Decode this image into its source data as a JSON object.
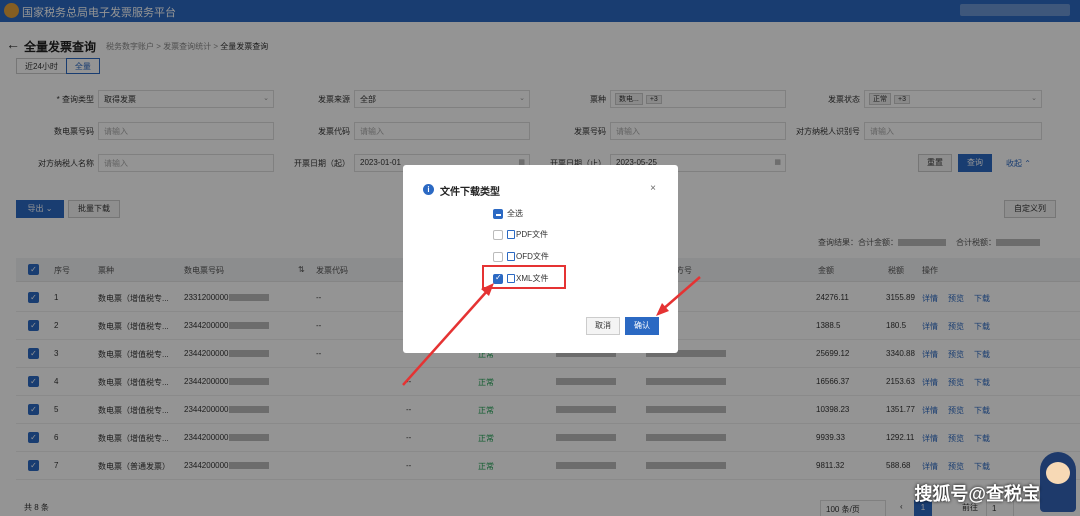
{
  "app": {
    "title": "国家税务总局电子发票服务平台"
  },
  "page": {
    "title": "全量发票查询",
    "breadcrumb": [
      "税务数字账户",
      "发票查询统计",
      "全量发票查询"
    ],
    "back_icon": "arrow-left-icon"
  },
  "time_tabs": [
    "近24小时",
    "全量"
  ],
  "filters": {
    "query_type": {
      "label": "* 查询类型",
      "value": "取得发票"
    },
    "invoice_source": {
      "label": "发票来源",
      "value": "全部"
    },
    "invoice_kind": {
      "label": "票种",
      "tag": "数电...",
      "more": "+3"
    },
    "invoice_status": {
      "label": "发票状态",
      "tag": "正常",
      "more": "+3"
    },
    "digital_no": {
      "label": "数电票号码",
      "placeholder": "请输入"
    },
    "invoice_code": {
      "label": "发票代码",
      "placeholder": "请输入"
    },
    "invoice_no": {
      "label": "发票号码",
      "placeholder": "请输入"
    },
    "counterparty_id": {
      "label": "对方纳税人识别号",
      "placeholder": "请输入"
    },
    "counterparty_name": {
      "label": "对方纳税人名称",
      "placeholder": "请输入"
    },
    "date_start": {
      "label": "开票日期（起）",
      "value": "2023-01-01"
    },
    "date_end": {
      "label": "开票日期（止）",
      "value": "2023-05-25"
    }
  },
  "buttons": {
    "reset": "重置",
    "search": "查询",
    "collapse": "收起",
    "export": "导出",
    "batch_download": "批量下载",
    "custom_columns": "自定义列"
  },
  "summary": {
    "result": "查询结果：",
    "total_amount": "合计金额：",
    "total_tax": "合计税额："
  },
  "table": {
    "headers": [
      "序号",
      "票种",
      "数电票号码",
      "发票代码",
      "",
      "",
      "对方号",
      "金额",
      "税额",
      "操作"
    ],
    "rows": [
      {
        "no": "1",
        "kind": "数电票（增值税专...",
        "number": "2331200000",
        "code": "--",
        "status": "",
        "amount": "24276.11",
        "tax": "3155.89"
      },
      {
        "no": "2",
        "kind": "数电票（增值税专...",
        "number": "2344200000",
        "code": "--",
        "status": "",
        "amount": "1388.5",
        "tax": "180.5"
      },
      {
        "no": "3",
        "kind": "数电票（增值税专...",
        "number": "2344200000",
        "code": "--",
        "status": "正常",
        "amount": "25699.12",
        "tax": "3340.88"
      },
      {
        "no": "4",
        "kind": "数电票（增值税专...",
        "number": "2344200000",
        "code": "--",
        "status": "正常",
        "amount": "16566.37",
        "tax": "2153.63"
      },
      {
        "no": "5",
        "kind": "数电票（增值税专...",
        "number": "2344200000",
        "code": "--",
        "status": "正常",
        "amount": "10398.23",
        "tax": "1351.77"
      },
      {
        "no": "6",
        "kind": "数电票（增值税专...",
        "number": "2344200000",
        "code": "--",
        "status": "正常",
        "amount": "9939.33",
        "tax": "1292.11"
      },
      {
        "no": "7",
        "kind": "数电票（普通发票）",
        "number": "2344200000",
        "code": "--",
        "status": "正常",
        "amount": "9811.32",
        "tax": "588.68"
      }
    ],
    "actions": [
      "详情",
      "预览",
      "下载"
    ]
  },
  "footer": {
    "total": "共 8 条",
    "page_size": "100 条/页",
    "goto": "前往",
    "page": "1"
  },
  "modal": {
    "title": "文件下载类型",
    "options": [
      {
        "label": "全选",
        "state": "indeterminate"
      },
      {
        "label": "PDF文件",
        "state": "unchecked"
      },
      {
        "label": "OFD文件",
        "state": "unchecked"
      },
      {
        "label": "XML文件",
        "state": "checked"
      }
    ],
    "cancel": "取消",
    "confirm": "确认"
  },
  "watermark": "搜狐号@查税宝",
  "colors": {
    "primary": "#2b69c3",
    "annotation": "#e53333",
    "status_green": "#1a9f50"
  }
}
